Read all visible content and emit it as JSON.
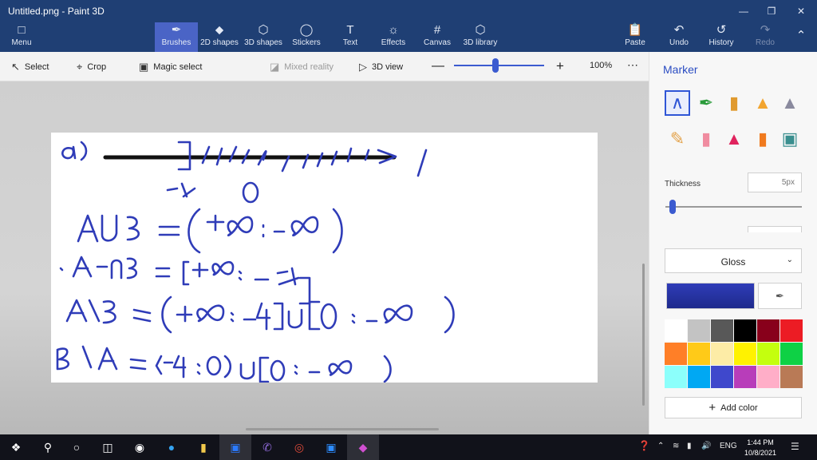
{
  "window": {
    "title": "Untitled.png - Paint 3D"
  },
  "ribbon": {
    "menu": "Menu",
    "tabs": [
      "Brushes",
      "2D shapes",
      "3D shapes",
      "Stickers",
      "Text",
      "Effects",
      "Canvas",
      "3D library"
    ],
    "actions": {
      "paste": "Paste",
      "undo": "Undo",
      "history": "History",
      "redo": "Redo"
    }
  },
  "toolbar": {
    "select": "Select",
    "crop": "Crop",
    "magic_select": "Magic select",
    "mixed_reality": "Mixed reality",
    "view_3d": "3D view",
    "zoom": "100%",
    "zoom_level": 0.46
  },
  "panel": {
    "title": "Marker",
    "thickness_label": "Thickness",
    "thickness_value": "5px",
    "thickness_level": 0.05,
    "finish": "Gloss",
    "add_color": "Add color",
    "current_color": "#2f3cb8",
    "brushes": [
      "marker-icon",
      "calligraphy-pen-icon",
      "oil-brush-icon",
      "watercolor-icon",
      "pixel-pen-icon",
      "pencil-icon",
      "eraser-icon",
      "crayon-icon",
      "spray-can-icon",
      "fill-bucket-icon"
    ],
    "palette": [
      "#ffffff",
      "#c3c3c3",
      "#585858",
      "#000000",
      "#88001b",
      "#ec1c24",
      "#ff7f27",
      "#ffca18",
      "#fdeca6",
      "#fff200",
      "#c4ff0e",
      "#0ed145",
      "#8cfffb",
      "#00a8f3",
      "#3f48cc",
      "#b83dba",
      "#ffaec8",
      "#b97a56"
    ]
  },
  "taskbar": {
    "time": "1:44 PM",
    "date": "10/8/2021",
    "lang": "ENG"
  }
}
